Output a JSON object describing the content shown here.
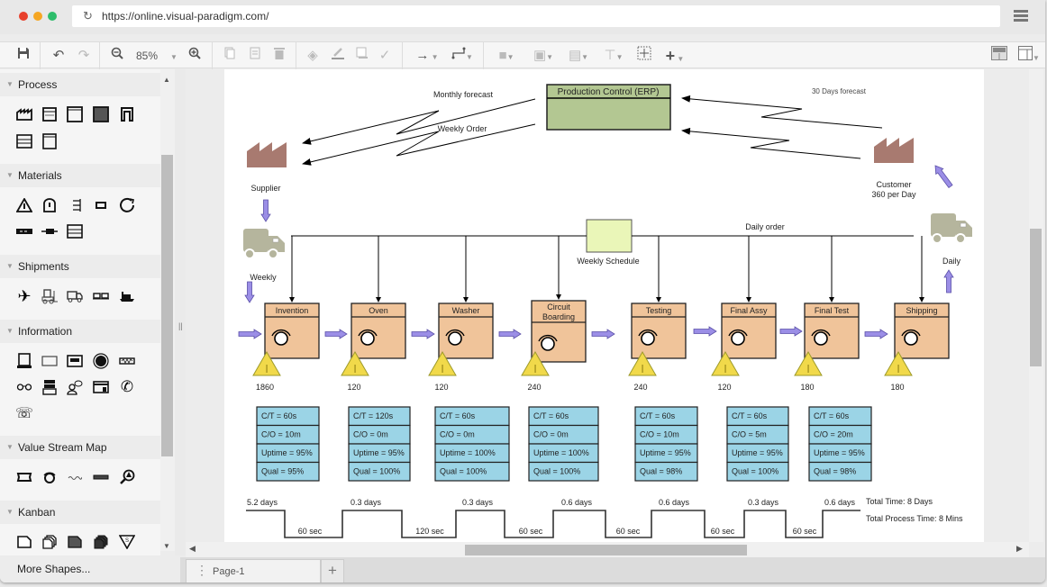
{
  "browser": {
    "url": "https://online.visual-paradigm.com/"
  },
  "toolbar": {
    "zoom_level": "85%",
    "buttons": [
      "save",
      "undo",
      "redo",
      "zoom-out",
      "zoom-dropdown",
      "zoom-in",
      "copy",
      "paste",
      "delete",
      "fill-color",
      "line-color",
      "shadow",
      "format-painter",
      "connector-style",
      "connector-type",
      "arrange",
      "group",
      "align",
      "distribute",
      "select-all",
      "insert",
      "toggle-panel",
      "layout"
    ]
  },
  "sidebar": {
    "categories": [
      {
        "label": "Process",
        "icons": [
          "factory-icon",
          "data-box-icon",
          "process-box-icon",
          "shared-process-icon",
          "outside-source-icon",
          "table-icon",
          "dedicated-process-icon"
        ]
      },
      {
        "label": "Materials",
        "icons": [
          "inventory-icon",
          "supermarket-icon",
          "fifo-lane-icon",
          "safety-stock-icon",
          "pull-circle-icon",
          "push-arrow-icon",
          "external-shipment-icon",
          "buffer-icon"
        ]
      },
      {
        "label": "Shipments",
        "icons": [
          "airplane-icon",
          "forklift-icon",
          "truck-icon",
          "rail-icon",
          "ship-icon"
        ]
      },
      {
        "label": "Information",
        "icons": [
          "production-control-icon",
          "manual-info-icon",
          "electronic-info-icon",
          "signal-icon",
          "schedule-icon",
          "go-see-icon",
          "load-leveling-icon",
          "verbal-info-icon",
          "kanban-post-icon",
          "phone-icon",
          "telephone-icon"
        ]
      },
      {
        "label": "Value Stream Map",
        "icons": [
          "kaizen-burst-icon",
          "operator-icon",
          "other-info-icon",
          "timeline-icon",
          "quality-problem-icon"
        ]
      },
      {
        "label": "Kanban",
        "icons": [
          "production-kanban-icon",
          "kanban-batch-icon",
          "withdrawal-kanban-icon",
          "kanban-arriving-icon",
          "signal-kanban-icon"
        ]
      }
    ],
    "more_shapes": "More Shapes..."
  },
  "diagram": {
    "colors": {
      "factory": "#a87a70",
      "erp_fill": "#b3c792",
      "process_fill": "#f0c49a",
      "data_fill": "#9bd4e6",
      "schedule_fill": "#eaf6b8",
      "inventory_fill": "#f1d94a",
      "push_arrow": "#9b8ee6",
      "truck": "#b5b59d"
    },
    "production_control": "Production Control (ERP)",
    "monthly_forecast": "Monthly forecast",
    "weekly_order": "Weekly Order",
    "days_forecast": "30 Days forecast",
    "supplier": "Supplier",
    "customer_line1": "Customer",
    "customer_line2": "360 per Day",
    "weekly": "Weekly",
    "daily": "Daily",
    "weekly_schedule": "Weekly Schedule",
    "daily_order": "Daily order",
    "processes": [
      {
        "name": "Invention",
        "inventory": "1860",
        "ct": "C/T = 60s",
        "co": "C/O = 10m",
        "uptime": "Uptime = 95%",
        "qual": "Qual = 95%"
      },
      {
        "name": "Oven",
        "inventory": "120",
        "ct": "C/T = 120s",
        "co": "C/O = 0m",
        "uptime": "Uptime = 95%",
        "qual": "Qual = 100%"
      },
      {
        "name": "Washer",
        "inventory": "120",
        "ct": "C/T = 60s",
        "co": "C/O = 0m",
        "uptime": "Uptime = 100%",
        "qual": "Qual = 100%"
      },
      {
        "name_line1": "Circuit",
        "name_line2": "Boarding",
        "inventory": "240",
        "ct": "C/T = 60s",
        "co": "C/O = 0m",
        "uptime": "Uptime = 100%",
        "qual": "Qual = 100%"
      },
      {
        "name": "Testing",
        "inventory": "240",
        "ct": "C/T = 60s",
        "co": "C/O = 10m",
        "uptime": "Uptime = 95%",
        "qual": "Qual = 98%"
      },
      {
        "name": "Final Assy",
        "inventory": "120",
        "ct": "C/T = 60s",
        "co": "C/O = 5m",
        "uptime": "Uptime = 95%",
        "qual": "Qual = 100%"
      },
      {
        "name": "Final Test",
        "inventory": "180",
        "ct": "C/T = 60s",
        "co": "C/O = 20m",
        "uptime": "Uptime = 95%",
        "qual": "Qual = 98%"
      },
      {
        "name": "Shipping",
        "inventory": "180"
      }
    ],
    "timeline": {
      "days": [
        "5.2 days",
        "0.3 days",
        "0.3 days",
        "0.6 days",
        "0.6 days",
        "0.3 days",
        "0.6 days"
      ],
      "secs": [
        "60 sec",
        "120 sec",
        "60 sec",
        "60 sec",
        "60 sec",
        "60 sec"
      ],
      "total_time": "Total Time: 8 Days",
      "total_process_time": "Total Process Time: 8 Mins"
    }
  },
  "pages": {
    "current": "Page-1"
  }
}
